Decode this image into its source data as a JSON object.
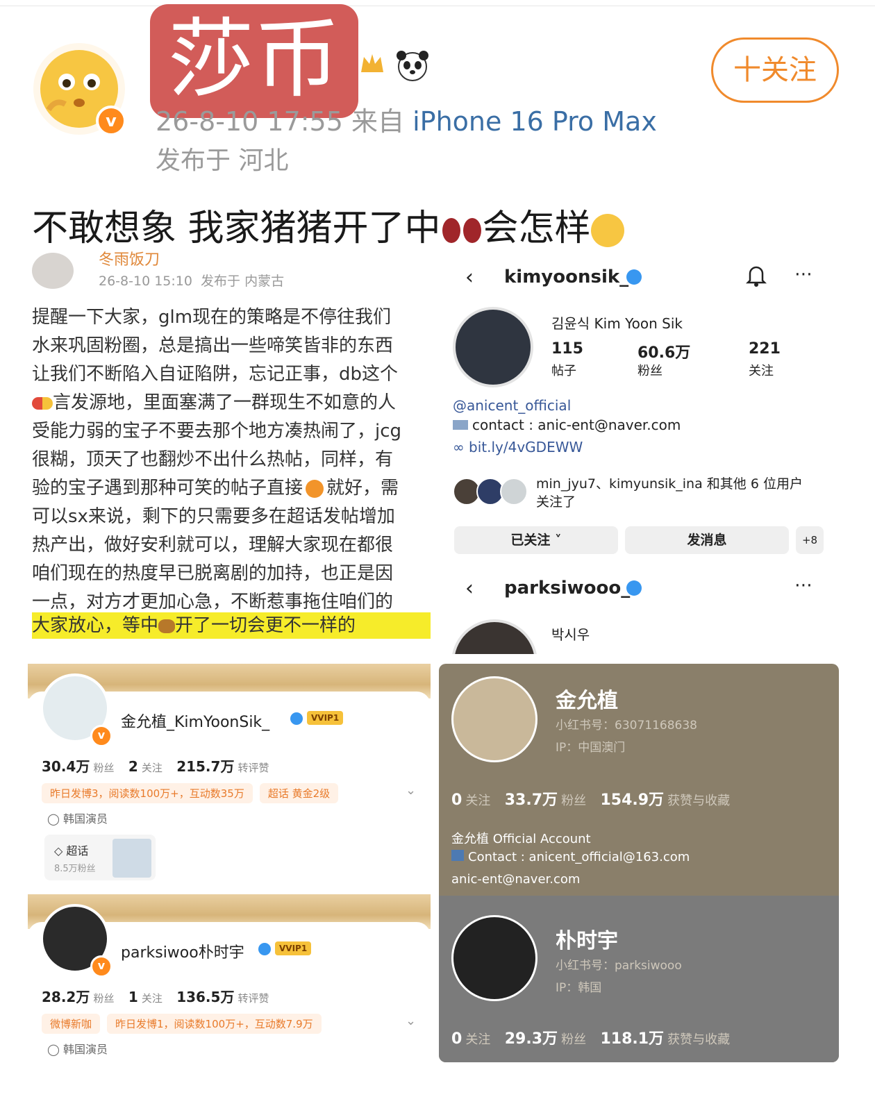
{
  "header": {
    "watermark": "莎币",
    "meta_time": "26-8-10 17:55",
    "meta_from": "来自",
    "meta_device": "iPhone 16 Pro Max",
    "meta_location": "发布于 河北",
    "follow_label": "十关注"
  },
  "post": {
    "text_before": "不敢想象 我家猪猪开了中",
    "text_after": "会怎样"
  },
  "quoted_post": {
    "author": "冬雨饭刀",
    "date": "26-8-10 15:10",
    "location": "发布于 内蒙古",
    "lines": [
      "提醒一下大家，glm现在的策略是不停往我们",
      "水来巩固粉圈，总是搞出一些啼笑皆非的东西",
      "让我们不断陷入自证陷阱，忘记正事，db这个",
      "言发源地，里面塞满了一群现生不如意的人",
      "受能力弱的宝子不要去那个地方凑热闹了，jcg",
      "很糊，顶天了也翻炒不出什么热帖，同样，有",
      "验的宝子遇到那种可笑的帖子直接",
      "可以sx来说，剩下的只需要多在超话发帖增加",
      "热产出，做好安利就可以，理解大家现在都很",
      "咱们现在的热度早已脱离剧的加持，也正是因",
      "一点，对方才更加心急，不断惹事拖住咱们的"
    ],
    "line7_after": "就好，需",
    "highlight_before": "大家放心，等中",
    "highlight_after": "开了一切会更不一样的"
  },
  "instagram_1": {
    "username": "kimyoonsik_",
    "fullname": "김윤식 Kim Yoon Sik",
    "posts": "115",
    "posts_label": "帖子",
    "followers": "60.6万",
    "followers_label": "粉丝",
    "following": "221",
    "following_label": "关注",
    "link_account": "@anicent_official",
    "contact": "contact : anic-ent@naver.com",
    "bio_link": "bit.ly/4vGDEWW",
    "mutual": "min_jyu7、kimyunsik_ina 和其他 6 位用户",
    "mutual2": "关注了",
    "btn_following": "已关注",
    "btn_message": "发消息",
    "btn_add": "+8"
  },
  "instagram_2": {
    "username": "parksiwooo_",
    "fullname": "박시우"
  },
  "weibo_1": {
    "name": "金允植_KimYoonSik_",
    "vip": "VVIP1",
    "fans": "30.4万",
    "fans_label": "粉丝",
    "follow": "2",
    "follow_label": "关注",
    "likes": "215.7万",
    "likes_label": "转评赞",
    "tag1": "昨日发博3，阅读数100万+，互动数35万",
    "tag2": "超话 黄金2级",
    "role": "韩国演员",
    "supertopic": "超话",
    "supertopic_fans": "8.5万粉丝"
  },
  "weibo_2": {
    "name": "parksiwoo朴时宇",
    "vip": "VVIP1",
    "fans": "28.2万",
    "fans_label": "粉丝",
    "follow": "1",
    "follow_label": "关注",
    "likes": "136.5万",
    "likes_label": "转评赞",
    "tag1": "微博新咖",
    "tag2": "昨日发博1，阅读数100万+，互动数7.9万",
    "role": "韩国演员"
  },
  "xhs_1": {
    "name": "金允植",
    "id": "小红书号：63071168638",
    "ip": "IP：中国澳门",
    "follow": "0",
    "follow_label": "关注",
    "fans": "33.7万",
    "fans_label": "粉丝",
    "likes": "154.9万",
    "likes_label": "获赞与收藏",
    "bio1": "金允植 Official Account",
    "bio2": "Contact : anicent_official@163.com",
    "bio3": "anic-ent@naver.com"
  },
  "xhs_2": {
    "name": "朴时宇",
    "id": "小红书号：parksiwooo",
    "ip": "IP：韩国",
    "follow": "0",
    "follow_label": "关注",
    "fans": "29.3万",
    "fans_label": "粉丝",
    "likes": "118.1万",
    "likes_label": "获赞与收藏"
  },
  "colors": {
    "accent": "#f08a2c",
    "watermark": "#d25c59",
    "link": "#3a6ea5",
    "verified": "#3897f0"
  }
}
